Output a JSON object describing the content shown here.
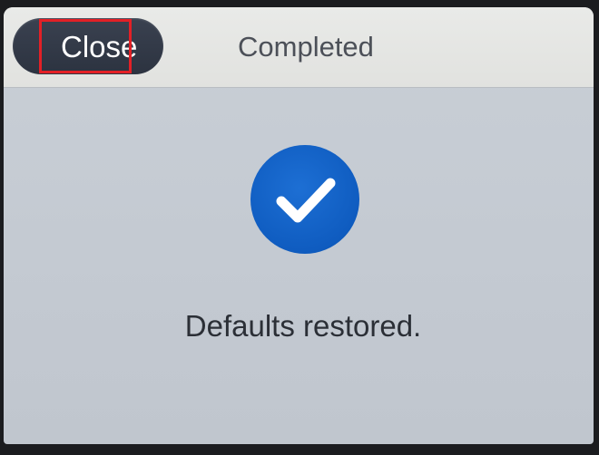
{
  "header": {
    "close_label": "Close",
    "title": "Completed"
  },
  "main": {
    "status_icon": "checkmark-icon",
    "message": "Defaults restored."
  },
  "colors": {
    "accent_blue": "#0f5cc0",
    "close_button": "#2f3643",
    "highlight_red": "#e32026"
  }
}
